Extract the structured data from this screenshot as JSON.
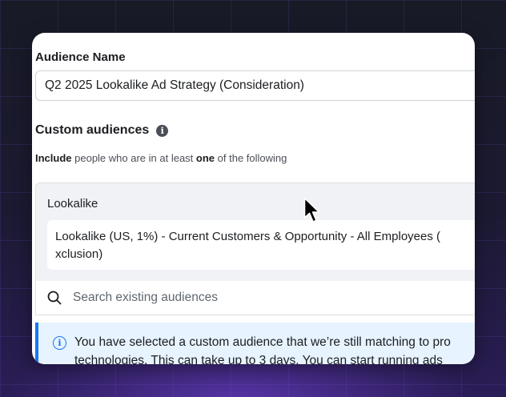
{
  "audience_name": {
    "label": "Audience Name",
    "value": "Q2 2025 Lookalike Ad Strategy (Consideration)"
  },
  "custom_audiences": {
    "title": "Custom audiences",
    "info_icon": "info-icon",
    "include_bold": "Include",
    "include_mid": " people who are in at least ",
    "include_one": "one",
    "include_end": " of the following",
    "group_label": "Lookalike",
    "selected_audience": "Lookalike (US, 1%) - Current Customers & Opportunity - All Employees (",
    "selected_audience_wrap": "xclusion)",
    "search_placeholder": "Search existing audiences",
    "search_icon": "search-icon"
  },
  "notice": {
    "icon": "info-outline-icon",
    "line1": "You have selected a custom audience that we’re still matching to pro",
    "line2": "technologies. This can take up to 3 days. You can start running ads"
  },
  "colors": {
    "accent": "#1877f2",
    "notice_bg": "#e7f3ff",
    "group_bg": "#f0f2f5"
  }
}
